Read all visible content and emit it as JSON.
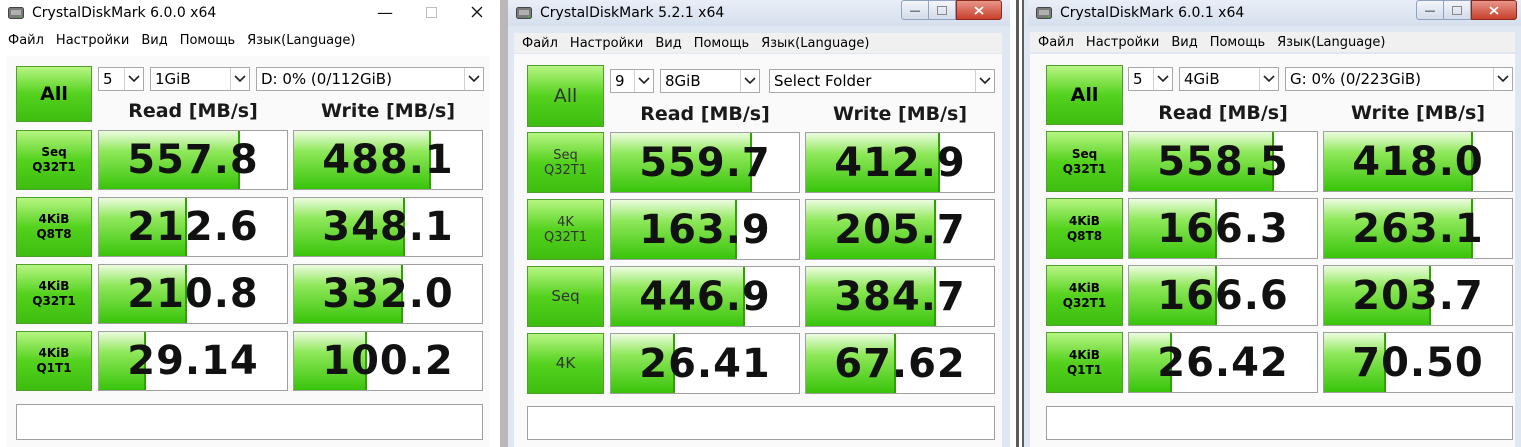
{
  "colors": {
    "button_green": "#54d21e",
    "bar_green": "#38c40a",
    "accent_blue": "#6b8fc9"
  },
  "windows": [
    {
      "title": "CrystalDiskMark 6.0.0 x64",
      "menu": [
        "Файл",
        "Настройки",
        "Вид",
        "Помощь",
        "Язык(Language)"
      ],
      "all_label": "All",
      "count": "5",
      "size": "1GiB",
      "drive": "D: 0% (0/112GiB)",
      "read_header": "Read [MB/s]",
      "write_header": "Write [MB/s]",
      "rows": [
        {
          "l1": "Seq",
          "l2": "Q32T1",
          "read": "557.8",
          "write": "488.1",
          "read_fill": 0.74,
          "write_fill": 0.72
        },
        {
          "l1": "4KiB",
          "l2": "Q8T8",
          "read": "212.6",
          "write": "348.1",
          "read_fill": 0.46,
          "write_fill": 0.58
        },
        {
          "l1": "4KiB",
          "l2": "Q32T1",
          "read": "210.8",
          "write": "332.0",
          "read_fill": 0.46,
          "write_fill": 0.57
        },
        {
          "l1": "4KiB",
          "l2": "Q1T1",
          "read": "29.14",
          "write": "100.2",
          "read_fill": 0.24,
          "write_fill": 0.38
        }
      ]
    },
    {
      "title": "CrystalDiskMark 5.2.1 x64",
      "menu": [
        "Файл",
        "Настройки",
        "Вид",
        "Помощь",
        "Язык(Language)"
      ],
      "all_label": "All",
      "count": "9",
      "size": "8GiB",
      "drive": "Select Folder",
      "read_header": "Read [MB/s]",
      "write_header": "Write [MB/s]",
      "rows": [
        {
          "l1": "Seq",
          "l2": "Q32T1",
          "read": "559.7",
          "write": "412.9",
          "read_fill": 0.74,
          "write_fill": 0.7
        },
        {
          "l1": "4K",
          "l2": "Q32T1",
          "read": "163.9",
          "write": "205.7",
          "read_fill": 0.66,
          "write_fill": 0.68
        },
        {
          "l1": "Seq",
          "l2": "",
          "read": "446.9",
          "write": "384.7",
          "read_fill": 0.7,
          "write_fill": 0.68
        },
        {
          "l1": "4K",
          "l2": "",
          "read": "26.41",
          "write": "67.62",
          "read_fill": 0.33,
          "write_fill": 0.47
        }
      ]
    },
    {
      "title": "CrystalDiskMark 6.0.1 x64",
      "menu": [
        "Файл",
        "Настройки",
        "Вид",
        "Помощь",
        "Язык(Language)"
      ],
      "all_label": "All",
      "count": "5",
      "size": "4GiB",
      "drive": "G: 0% (0/223GiB)",
      "read_header": "Read [MB/s]",
      "write_header": "Write [MB/s]",
      "rows": [
        {
          "l1": "Seq",
          "l2": "Q32T1",
          "read": "558.5",
          "write": "418.0",
          "read_fill": 0.76,
          "write_fill": 0.78
        },
        {
          "l1": "4KiB",
          "l2": "Q8T8",
          "read": "166.3",
          "write": "263.1",
          "read_fill": 0.46,
          "write_fill": 0.78
        },
        {
          "l1": "4KiB",
          "l2": "Q32T1",
          "read": "166.6",
          "write": "203.7",
          "read_fill": 0.46,
          "write_fill": 0.56
        },
        {
          "l1": "4KiB",
          "l2": "Q1T1",
          "read": "26.42",
          "write": "70.50",
          "read_fill": 0.22,
          "write_fill": 0.32
        }
      ]
    }
  ]
}
